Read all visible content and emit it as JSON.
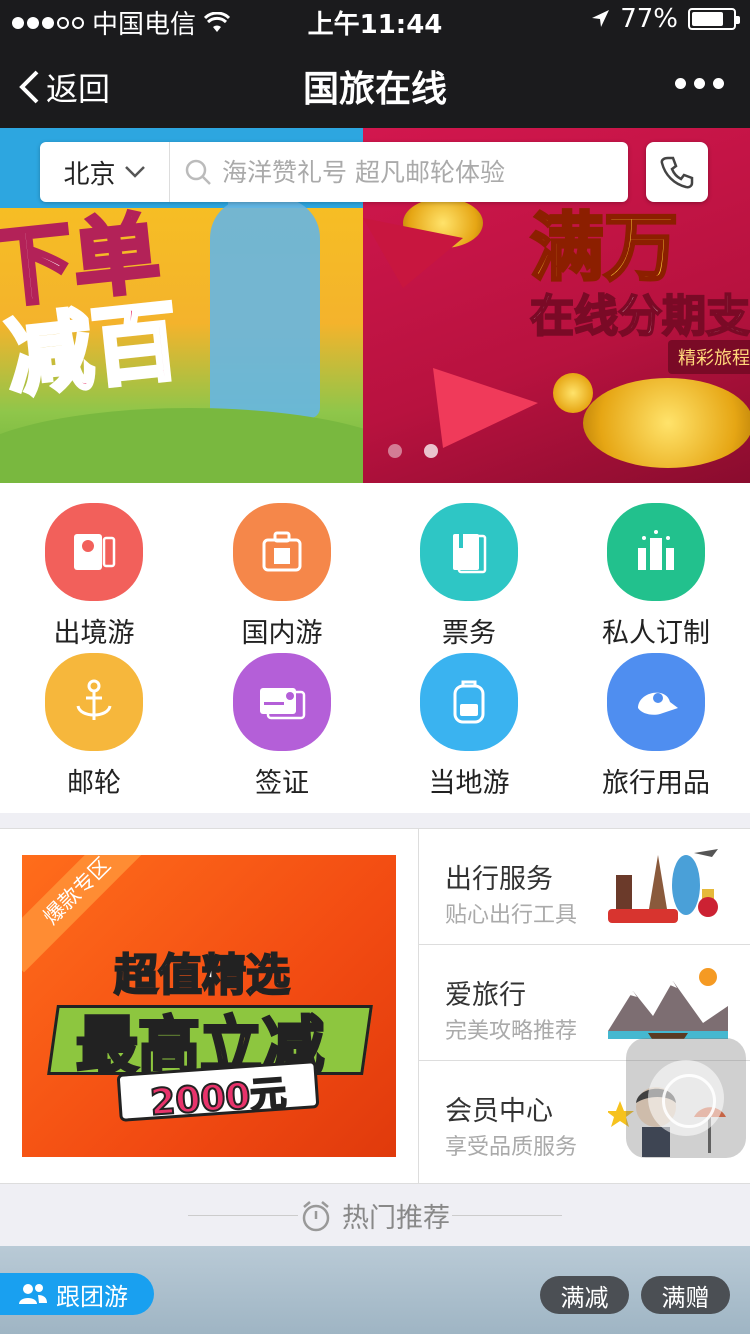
{
  "status_bar": {
    "carrier": "中国电信",
    "time": "上午11:44",
    "battery": "77%",
    "battery_level": 0.77
  },
  "nav": {
    "back_label": "返回",
    "title": "国旅在线"
  },
  "search": {
    "city": "北京",
    "placeholder": "海洋赞礼号 超凡邮轮体验"
  },
  "banner": {
    "left_line1": "下单",
    "left_line2": "减百",
    "right_title": "满万",
    "right_subtitle": "在线分期支",
    "right_tag": "精彩旅程",
    "active_slide": 2,
    "slide_count": 2
  },
  "categories": [
    {
      "label": "出境游",
      "icon": "passport-icon",
      "color": "#f2605b"
    },
    {
      "label": "国内游",
      "icon": "luggage-icon",
      "color": "#f5874a"
    },
    {
      "label": "票务",
      "icon": "ticket-icon",
      "color": "#2ec6c5"
    },
    {
      "label": "私人订制",
      "icon": "city-icon",
      "color": "#22c18d"
    },
    {
      "label": "邮轮",
      "icon": "anchor-icon",
      "color": "#f6b73c"
    },
    {
      "label": "签证",
      "icon": "visa-card-icon",
      "color": "#b45fd8"
    },
    {
      "label": "当地游",
      "icon": "backpack-icon",
      "color": "#3ab3f0"
    },
    {
      "label": "旅行用品",
      "icon": "cap-icon",
      "color": "#4f8ef0"
    }
  ],
  "promo": {
    "corner_label": "爆款专区",
    "headline": "超值精选",
    "main": "最高立减",
    "amount": "2000元"
  },
  "services": [
    {
      "name": "出行服务",
      "desc": "贴心出行工具",
      "icon": "landmarks-icon"
    },
    {
      "name": "爱旅行",
      "desc": "完美攻略推荐",
      "icon": "mountains-icon"
    },
    {
      "name": "会员中心",
      "desc": "享受品质服务",
      "icon": "member-icon"
    }
  ],
  "hot": {
    "label": "热门推荐"
  },
  "bottom_card": {
    "tag": "跟团游",
    "pills": [
      "满减",
      "满赠"
    ]
  }
}
